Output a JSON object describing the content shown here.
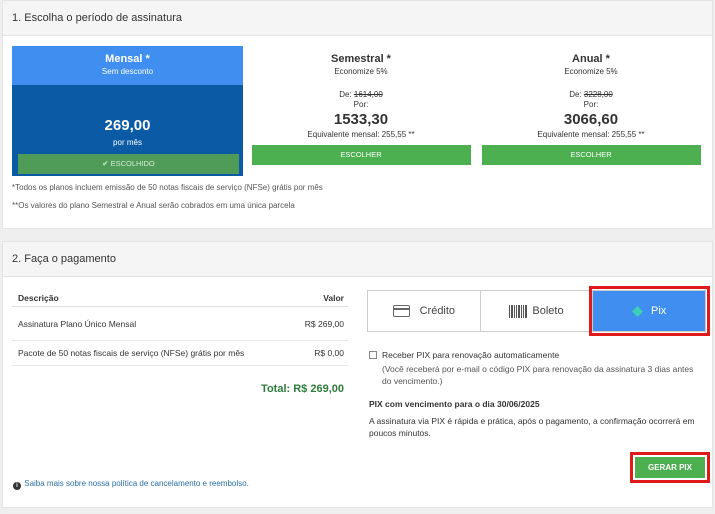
{
  "section1": {
    "title": "1. Escolha o período de assinatura",
    "plans": [
      {
        "name": "Mensal *",
        "sub": "Sem desconto",
        "price": "269,00",
        "per": "por mês",
        "button": "✔ ESCOLHIDO",
        "selected": true
      },
      {
        "name": "Semestral *",
        "sub": "Economize 5%",
        "de_label": "De:",
        "old_price": "1614,00",
        "por": "Por:",
        "price": "1533,30",
        "equivalent": "Equivalente mensal: 255,55 **",
        "button": "ESCOLHER"
      },
      {
        "name": "Anual *",
        "sub": "Economize 5%",
        "de_label": "De:",
        "old_price": "3228,00",
        "por": "Por:",
        "price": "3066,60",
        "equivalent": "Equivalente mensal: 255,55 **",
        "button": "ESCOLHER"
      }
    ],
    "note1": "*Todos os planos incluem emissão de 50 notas fiscais de serviço (NFSe) grátis por mês",
    "note2": "**Os valores do plano Semestral e Anual serão cobrados em uma única parcela"
  },
  "section2": {
    "title": "2. Faça o pagamento",
    "table": {
      "col_desc": "Descrição",
      "col_val": "Valor",
      "rows": [
        {
          "desc": "Assinatura Plano Único Mensal",
          "val": "R$ 269,00"
        },
        {
          "desc": "Pacote de 50 notas fiscais de serviço (NFSe) grátis por mês",
          "val": "R$ 0,00"
        }
      ],
      "total": "Total: R$ 269,00"
    },
    "policy": "Saiba mais sobre nossa política de cancelamento e reembolso.",
    "methods": [
      {
        "label": "Crédito",
        "icon": "credit-card-icon"
      },
      {
        "label": "Boleto",
        "icon": "barcode-icon"
      },
      {
        "label": "Pix",
        "icon": "pix-icon",
        "active": true
      }
    ],
    "pix": {
      "auto_label": "Receber PIX para renovação automaticamente",
      "auto_note": "(Você receberá por e-mail o código PIX para renovação da assinatura 3 dias antes do vencimento.)",
      "due": "PIX com vencimento para o dia 30/06/2025",
      "info": "A assinatura via PIX é rápida e prática, após o pagamento, a confirmação ocorrerá em poucos minutos.",
      "button": "GERAR PIX"
    }
  },
  "colors": {
    "primary": "#3f8ef0",
    "dark_blue": "#0a5aa6",
    "green": "#4caf50",
    "highlight_red": "#e0191b",
    "total_green": "#2e7d3a"
  }
}
